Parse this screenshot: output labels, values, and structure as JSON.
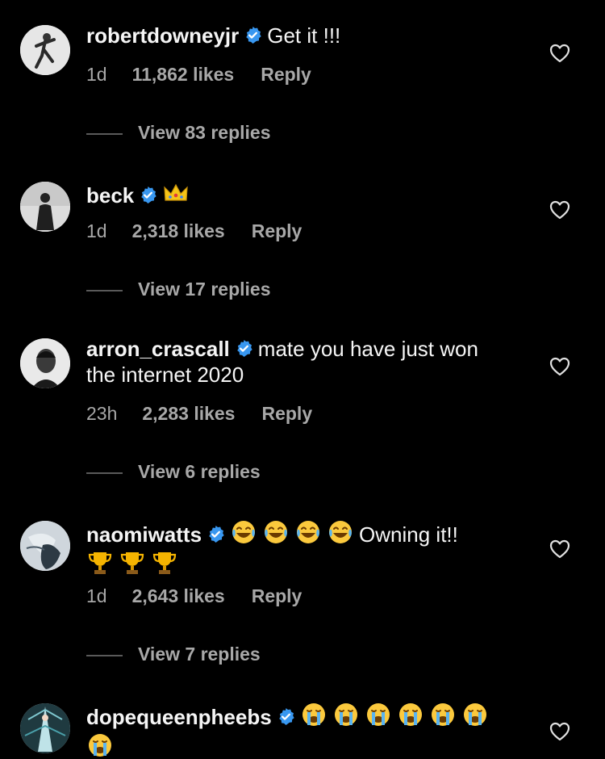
{
  "comments": [
    {
      "username": "robertdowneyjr",
      "text": "Get it !!!",
      "time": "1d",
      "likes": "11,862 likes",
      "reply": "Reply",
      "view_replies": "View 83 replies"
    },
    {
      "username": "beck",
      "text": "",
      "time": "1d",
      "likes": "2,318 likes",
      "reply": "Reply",
      "view_replies": "View 17 replies"
    },
    {
      "username": "arron_crascall",
      "text": "mate you have just won",
      "text_line2": "the internet 2020",
      "time": "23h",
      "likes": "2,283 likes",
      "reply": "Reply",
      "view_replies": "View 6 replies"
    },
    {
      "username": "naomiwatts",
      "text": "Owning it!!",
      "time": "1d",
      "likes": "2,643 likes",
      "reply": "Reply",
      "view_replies": "View 7 replies"
    },
    {
      "username": "dopequeenpheebs",
      "text": ""
    }
  ],
  "colors": {
    "background": "#000000",
    "primary_text": "#f5f5f5",
    "secondary_text": "#a8a8a8",
    "verified_blue": "#3897f0"
  },
  "icons": {
    "verified": "verified-badge-icon",
    "like": "heart-outline-icon",
    "emoji_crown": "crown-emoji",
    "emoji_laugh": "tears-of-joy-emoji",
    "emoji_trophy": "trophy-emoji",
    "emoji_sob": "loudly-crying-emoji"
  }
}
